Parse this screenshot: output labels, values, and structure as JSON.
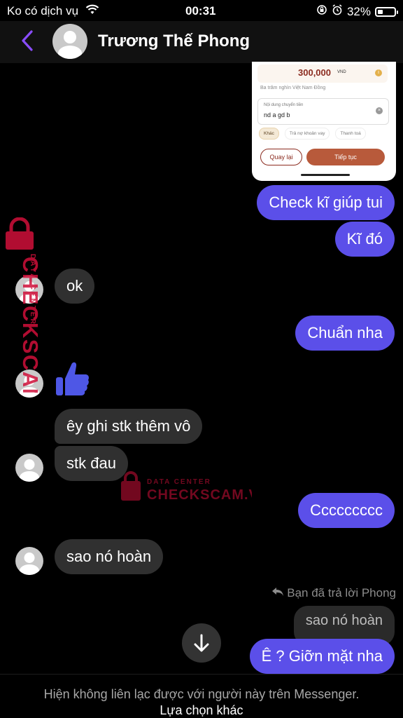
{
  "status_bar": {
    "carrier": "Ko có dịch vụ",
    "time": "00:31",
    "battery": "32%",
    "battery_level": 0.32
  },
  "header": {
    "contact_name": "Trương Thế Phong"
  },
  "screenshot": {
    "amount": "300,000",
    "currency": "VND",
    "amount_in_words": "Ba trăm nghìn Việt Nam Đồng",
    "memo_label": "Nội dung chuyển tiền",
    "memo_value": "nd a gd b",
    "chips": [
      "Khác",
      "Trả nợ khoản vay",
      "Thanh toá"
    ],
    "back_button": "Quay lại",
    "next_button": "Tiếp tục"
  },
  "messages": [
    {
      "from": "me",
      "text": "Check kĩ giúp tui"
    },
    {
      "from": "me",
      "text": "Kĩ đó"
    },
    {
      "from": "them",
      "text": "ok"
    },
    {
      "from": "me",
      "text": "Chuẩn nha"
    },
    {
      "from": "them",
      "type": "like"
    },
    {
      "from": "them",
      "text": "êy ghi stk thêm vô"
    },
    {
      "from": "them",
      "text": "stk đau"
    },
    {
      "from": "me",
      "text": "Ccccccccc"
    },
    {
      "from": "them",
      "text": "sao nó hoàn"
    },
    {
      "from": "me",
      "text": "Ê ? Giỡn mặt nha"
    }
  ],
  "reply": {
    "note": "Bạn đã trả lời Phong",
    "quoted_text": "sao nó hoàn"
  },
  "footer": {
    "notice": "Hiện không liên lạc được với người này trên Messenger.",
    "link": "Lựa chọn khác"
  },
  "watermark": {
    "brand": "CHECKSCAM.VN",
    "subtitle": "DATA CENTER"
  },
  "colors": {
    "accent": "#8a4dff",
    "outgoing_bubble": "#5b4fe9",
    "incoming_bubble": "#303030",
    "watermark": "#d0103a"
  }
}
